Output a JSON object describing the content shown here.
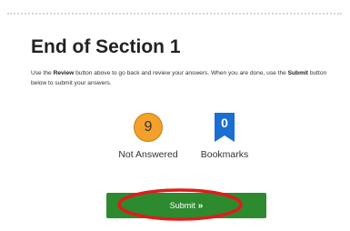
{
  "section": {
    "title": "End of Section 1"
  },
  "instructions": {
    "part1": "Use the ",
    "review_word": "Review",
    "part2": " button above to go back and review your answers. When you are done, use the ",
    "submit_word": "Submit",
    "part3": " button below to submit your answers."
  },
  "stats": {
    "not_answered": {
      "count": "9",
      "label": "Not Answered"
    },
    "bookmarks": {
      "count": "0",
      "label": "Bookmarks"
    }
  },
  "submit": {
    "label": "Submit",
    "chevron": "»"
  },
  "colors": {
    "not_answered_badge": "#f4a12b",
    "bookmark_badge": "#1a6fd1",
    "submit_button": "#2e8a2e",
    "highlight_ellipse": "#e01b1b"
  }
}
